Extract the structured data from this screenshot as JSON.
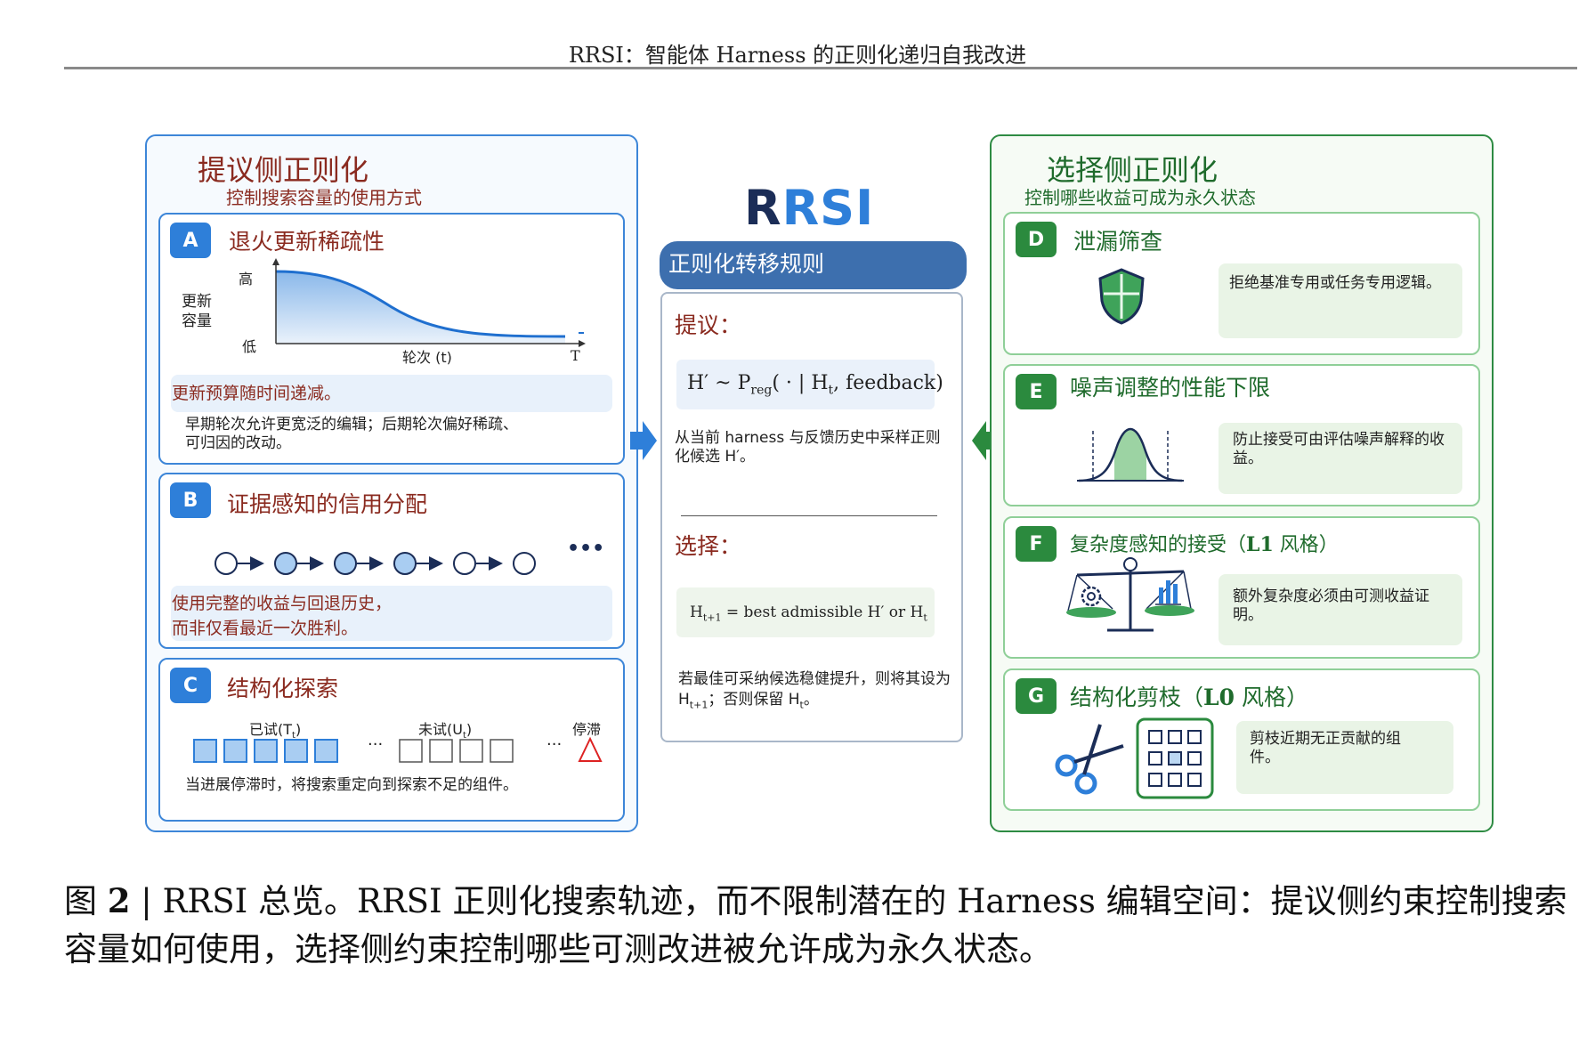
{
  "header": {
    "running_title": "RRSI：智能体 Harness 的正则化递归自我改进"
  },
  "left_panel": {
    "title": "提议侧正则化",
    "subtitle": "控制搜索容量的使用方式",
    "card_a": {
      "badge": "A",
      "title": "退火更新稀疏性",
      "y_label_high": "高",
      "y_label": "更新\n容量",
      "y_label_low": "低",
      "x_label": "轮次 (t)",
      "x_end_label": "T",
      "note": "更新预算随时间递减。",
      "desc": "早期轮次允许更宽泛的编辑；后期轮次偏好稀疏、可归因的改动。"
    },
    "card_b": {
      "badge": "B",
      "title": "证据感知的信用分配",
      "ellipsis": "•••",
      "note": "使用完整的收益与回退历史，\n而非仅看最近一次胜利。"
    },
    "card_c": {
      "badge": "C",
      "title": "结构化探索",
      "tried_label": "已试(T",
      "tried_sub": "t",
      "untried_label": "未试(U",
      "untried_sub": "t",
      "stall_label": "停滞",
      "dots": "···",
      "desc": "当进展停滞时，将搜索重定向到探索不足的组件。"
    }
  },
  "center": {
    "logo_dark": "R",
    "logo_blue": "RSI",
    "banner": "正则化转移规则",
    "propose_label": "提议：",
    "propose_formula": "H′ ~ P",
    "propose_formula_sub": "reg",
    "propose_formula_rest": "( · | H",
    "propose_formula_sub2": "t",
    "propose_formula_end": ", feedback)",
    "propose_desc": "从当前 harness 与反馈历史中采样正则化候选 H′。",
    "select_label": "选择：",
    "select_formula_a": "H",
    "select_formula_sub": "t+1",
    "select_formula_b": " = best admissible H′  or  H",
    "select_formula_sub2": "t",
    "select_desc_a": "若最佳可采纳候选稳健提升，则将其设为 H",
    "select_desc_sub": "t+1",
    "select_desc_b": "；否则保留 H",
    "select_desc_sub2": "t",
    "select_desc_c": "。"
  },
  "right_panel": {
    "title": "选择侧正则化",
    "subtitle": "控制哪些收益可成为永久状态",
    "card_d": {
      "badge": "D",
      "title": "泄漏筛查",
      "note": "拒绝基准专用或任务专用逻辑。"
    },
    "card_e": {
      "badge": "E",
      "title": "噪声调整的性能下限",
      "note": "防止接受可由评估噪声解释的收益。"
    },
    "card_f": {
      "badge": "F",
      "title": "复杂度感知的接受（",
      "title_bold": "L1",
      "title_end": " 风格）",
      "note": "额外复杂度必须由可测收益证明。"
    },
    "card_g": {
      "badge": "G",
      "title": "结构化剪枝（",
      "title_bold": "L0",
      "title_end": " 风格）",
      "note": "剪枝近期无正贡献的组件。"
    }
  },
  "caption": {
    "label": "图 ",
    "number": "2",
    "sep": " | ",
    "text": "RRSI 总览。RRSI 正则化搜索轨迹，而不限制潜在的 Harness 编辑空间：提议侧约束控制搜索容量如何使用，选择侧约束控制哪些可测改进被允许成为永久状态。"
  },
  "colors": {
    "blue": "#2e7fd9",
    "green": "#2b8a3e",
    "dark_red": "#8a2a1f",
    "navy": "#1b2d57"
  },
  "icons": [
    "right-arrow-icon",
    "left-arrow-icon",
    "shield-icon",
    "bell-curve-icon",
    "balance-scale-icon",
    "scissors-icon",
    "component-grid-icon",
    "warning-triangle-icon",
    "ellipsis-icon"
  ]
}
